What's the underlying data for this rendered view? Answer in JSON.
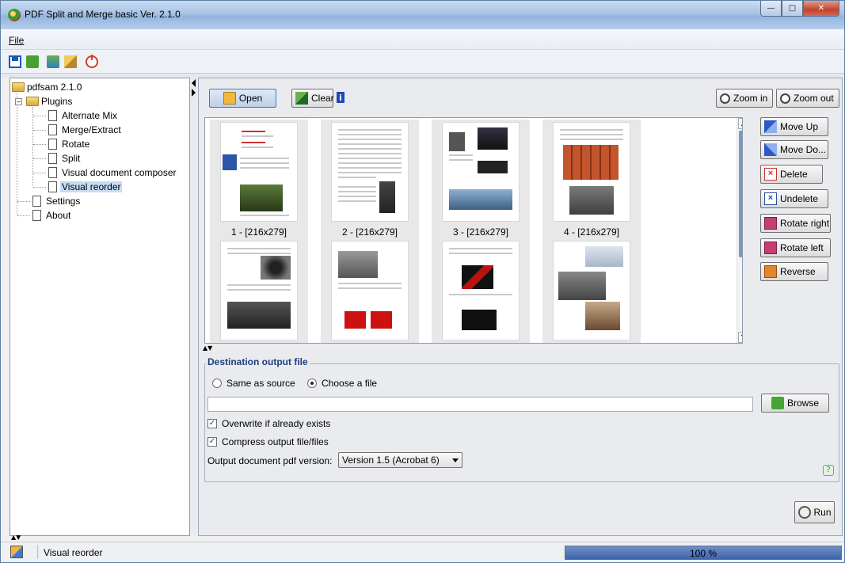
{
  "window": {
    "title": "PDF Split and Merge basic Ver. 2.1.0"
  },
  "menu": {
    "file_label": "File"
  },
  "tree": {
    "root": "pdfsam 2.1.0",
    "plugins": "Plugins",
    "items": [
      "Alternate Mix",
      "Merge/Extract",
      "Rotate",
      "Split",
      "Visual document composer",
      "Visual reorder"
    ],
    "settings": "Settings",
    "about": "About",
    "selected": "Visual reorder"
  },
  "toolbar": {
    "open_label": "Open",
    "clear_label": "Clear",
    "info_label": "i",
    "zoom_in_label": "Zoom in",
    "zoom_out_label": "Zoom out"
  },
  "pages": [
    {
      "caption": "1 - [216x279]"
    },
    {
      "caption": "2 - [216x279]"
    },
    {
      "caption": "3 - [216x279]"
    },
    {
      "caption": "4 - [216x279]"
    },
    {
      "caption": ""
    },
    {
      "caption": ""
    },
    {
      "caption": ""
    },
    {
      "caption": ""
    }
  ],
  "side_actions": {
    "move_up": "Move Up",
    "move_down": "Move Do...",
    "delete": "Delete",
    "undelete": "Undelete",
    "rotate_right": "Rotate right",
    "rotate_left": "Rotate left",
    "reverse": "Reverse"
  },
  "destination": {
    "title": "Destination output file",
    "same_as_source": "Same as source",
    "choose_file": "Choose a file",
    "selected_option": "Choose a file",
    "path_value": "",
    "browse_label": "Browse",
    "overwrite_label": "Overwrite if already exists",
    "overwrite_checked": true,
    "compress_label": "Compress output file/files",
    "compress_checked": true,
    "version_label": "Output document pdf version:",
    "version_value": "Version 1.5 (Acrobat 6)"
  },
  "run_label": "Run",
  "status": {
    "text": "Visual reorder",
    "progress_text": "100 %",
    "progress": 1.0
  },
  "colors": {
    "accent": "#3f63a9",
    "selection": "#c7dcf4",
    "group_title": "#1f3d7a"
  }
}
